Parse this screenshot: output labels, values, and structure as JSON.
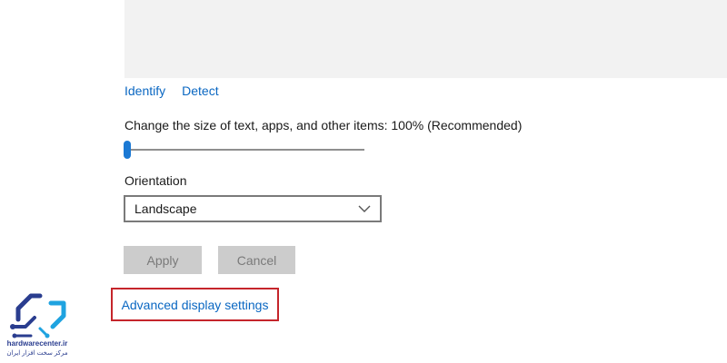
{
  "display": {
    "identify_label": "Identify",
    "detect_label": "Detect",
    "scale_label": "Change the size of text, apps, and other items: 100% (Recommended)",
    "scale_level": 0,
    "orientation_label": "Orientation",
    "orientation_value": "Landscape",
    "apply_label": "Apply",
    "cancel_label": "Cancel",
    "advanced_link": "Advanced display settings"
  },
  "watermark": {
    "site": "hardwarecenter.ir",
    "tagline": "مرکز سخت افزار ایران",
    "logo_icon": "circuit-logo-icon"
  },
  "colors": {
    "link": "#0a67c2",
    "accent": "#1b79d4",
    "highlight_border": "#c5252b",
    "logo_dark": "#2a3d8f",
    "logo_light": "#1fa3e0"
  }
}
